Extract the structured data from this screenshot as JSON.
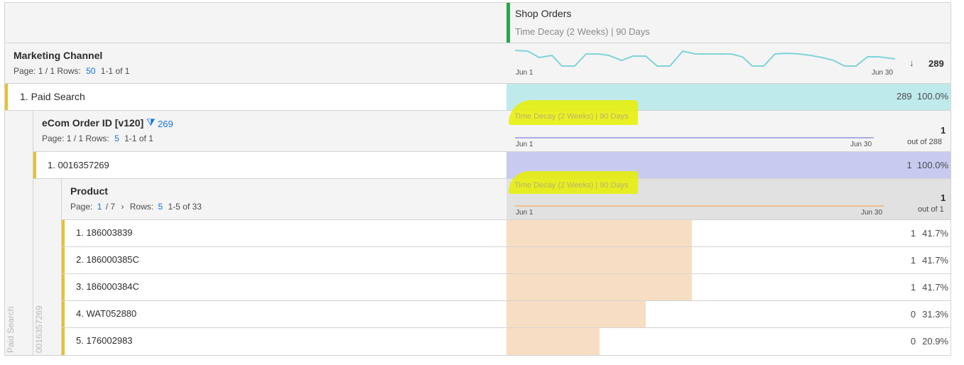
{
  "metric": {
    "name": "Shop Orders",
    "attribution": "Time Decay (2 Weeks) | 90 Days"
  },
  "marketing": {
    "title": "Marketing Channel",
    "page_label": "Page: 1 / 1 Rows:",
    "rows_value": "50",
    "range": "1-1 of 1",
    "total": "289",
    "trend_start": "Jun 1",
    "trend_end": "Jun 30",
    "row": {
      "label": "1. Paid Search",
      "value": "289",
      "pct": "100.0%"
    }
  },
  "order": {
    "title": "eCom Order ID [v120]",
    "filter_count": "269",
    "page_label": "Page: 1 / 1 Rows:",
    "rows_value": "5",
    "range": "1-1 of 1",
    "ghost_attribution": "Time Decay (2 Weeks) | 90 Days",
    "total": "1",
    "out_of": "out of 288",
    "trend_start": "Jun 1",
    "trend_end": "Jun 30",
    "row": {
      "label": "1. 0016357269",
      "value": "1",
      "pct": "100.0%"
    }
  },
  "product": {
    "title": "Product",
    "page_prefix": "Page:",
    "page_current": "1",
    "page_rest": "/ 7",
    "rows_label": "Rows:",
    "rows_value": "5",
    "range": "1-5 of 33",
    "ghost_attribution": "Time Decay (2 Weeks) | 90 Days",
    "total": "1",
    "out_of": "out of 1",
    "trend_start": "Jun 1",
    "trend_end": "Jun 30",
    "rows": [
      {
        "label": "1. 186003839",
        "value": "1",
        "pct": "41.7%",
        "share": 0.417
      },
      {
        "label": "2. 186000385C",
        "value": "1",
        "pct": "41.7%",
        "share": 0.417
      },
      {
        "label": "3. 186000384C",
        "value": "1",
        "pct": "41.7%",
        "share": 0.417
      },
      {
        "label": "4. WAT052880",
        "value": "0",
        "pct": "31.3%",
        "share": 0.313
      },
      {
        "label": "5. 176002983",
        "value": "0",
        "pct": "20.9%",
        "share": 0.209
      }
    ]
  },
  "side_labels": {
    "outer": "Paid Search",
    "inner": "0016357269"
  },
  "colors": {
    "teal": "#bfeaec",
    "lavender": "#c8cbef",
    "peach": "#f7dec2",
    "gold": "#e5c232",
    "green": "#2da44e"
  }
}
